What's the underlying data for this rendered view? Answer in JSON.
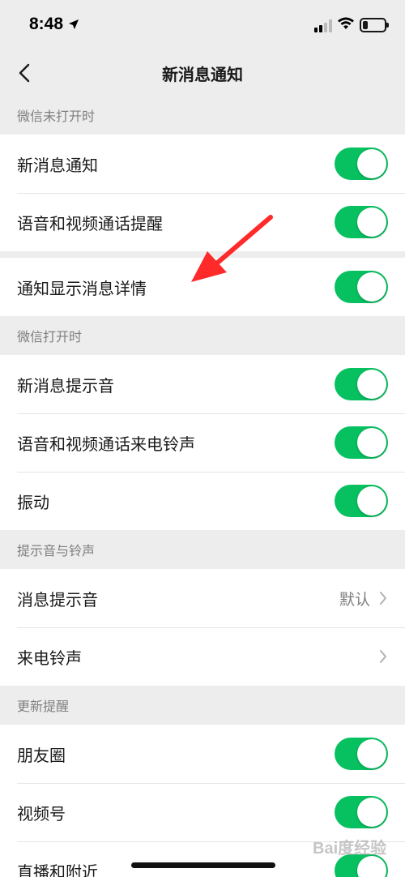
{
  "status_bar": {
    "time": "8:48"
  },
  "nav": {
    "title": "新消息通知"
  },
  "sections": {
    "wechat_closed": {
      "header": "微信未打开时",
      "rows": [
        "新消息通知",
        "语音和视频通话提醒"
      ],
      "detail_row": "通知显示消息详情"
    },
    "wechat_open": {
      "header": "微信打开时",
      "rows": [
        "新消息提示音",
        "语音和视频通话来电铃声",
        "振动"
      ]
    },
    "sounds": {
      "header": "提示音与铃声",
      "rows": [
        {
          "label": "消息提示音",
          "value": "默认"
        },
        {
          "label": "来电铃声",
          "value": ""
        }
      ]
    },
    "updates": {
      "header": "更新提醒",
      "rows": [
        "朋友圈",
        "视频号",
        "直播和附近"
      ]
    }
  },
  "toggles": {
    "new_message": true,
    "call_reminder": true,
    "show_detail": true,
    "message_sound": true,
    "ringtone": true,
    "vibrate": true,
    "moments": true,
    "channels": true,
    "live_nearby": true
  },
  "watermark": "Bai度经验",
  "colors": {
    "accent": "#07c160",
    "background": "#ededed",
    "annotation_arrow": "#ff2a2a"
  }
}
